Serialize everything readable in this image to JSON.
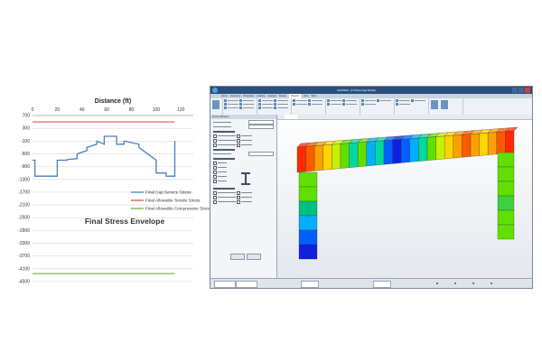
{
  "chart_data": {
    "type": "line",
    "title": "Final Stress Envelope",
    "x_axis": {
      "label": "Distance (ft)",
      "ticks": [
        0,
        20,
        40,
        60,
        80,
        100,
        120
      ],
      "range": [
        0,
        130
      ],
      "position": "top"
    },
    "y_axis": {
      "label": "",
      "ticks": [
        700,
        300,
        -100,
        -500,
        -900,
        -1300,
        -1700,
        -2100,
        -2500,
        -2900,
        -3300,
        -3700,
        -4100,
        -4500
      ],
      "range": [
        -4500,
        700
      ]
    },
    "grid": "horizontal",
    "legend_position": "middle-right",
    "series": [
      {
        "name": "Final Cap Service Stress",
        "color": "#4a7fc1",
        "x": [
          0,
          2,
          2,
          20,
          20,
          28,
          28,
          36,
          36,
          44,
          44,
          52,
          52,
          58,
          58,
          68,
          68,
          74,
          74,
          86,
          86,
          100,
          100,
          108,
          108,
          115,
          115
        ],
        "y": [
          -700,
          -700,
          -1200,
          -1200,
          -700,
          -700,
          -680,
          -650,
          -500,
          -400,
          -300,
          -200,
          -100,
          -200,
          50,
          50,
          -200,
          -200,
          -100,
          -200,
          -300,
          -700,
          -1100,
          -1100,
          -1200,
          -1200,
          -100
        ]
      },
      {
        "name": "Final Allowable Tensile Stress",
        "color": "#d9534f",
        "x": [
          0,
          115
        ],
        "y": [
          500,
          500
        ]
      },
      {
        "name": "Final Allowable Compressive Stress",
        "color": "#7fae3b",
        "x": [
          0,
          115
        ],
        "y": [
          -4250,
          -4250
        ]
      }
    ]
  },
  "app": {
    "title": "SAP2000 - [C:\\Final Cap Model]",
    "ribbon_tabs": [
      "Home",
      "Geometry",
      "Properties",
      "Loading",
      "Analysis",
      "Design",
      "Results",
      "View",
      "Tools"
    ],
    "active_tab": "Results",
    "panel_title": "Frame Stresses",
    "colors": {
      "title_bar": "#2b4f7e",
      "ribbon": "#eef2f7",
      "panel": "#f3f5f8"
    }
  }
}
